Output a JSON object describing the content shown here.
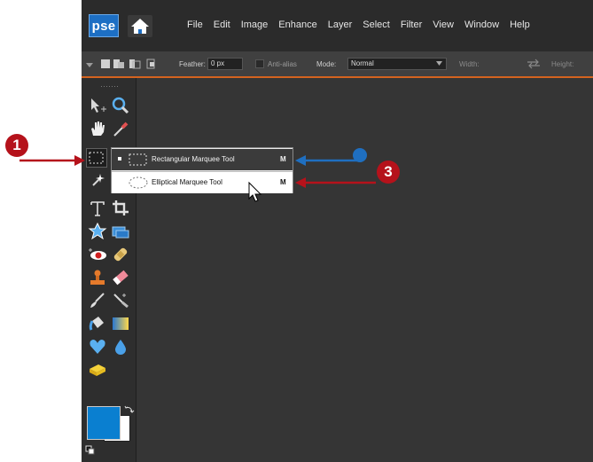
{
  "app": {
    "logo_text": "pse",
    "menu": [
      "File",
      "Edit",
      "Image",
      "Enhance",
      "Layer",
      "Select",
      "Filter",
      "View",
      "Window",
      "Help"
    ]
  },
  "options": {
    "feather_label": "Feather:",
    "feather_value": "0 px",
    "antialias_label": "Anti-alias",
    "mode_label": "Mode:",
    "mode_value": "Normal",
    "width_label": "Width:",
    "height_label": "Height:"
  },
  "flyout": {
    "items": [
      {
        "label": "Rectangular Marquee Tool",
        "shortcut": "M",
        "selected": true
      },
      {
        "label": "Elliptical Marquee Tool",
        "shortcut": "M",
        "selected": false
      }
    ]
  },
  "callouts": {
    "one": "1",
    "three": "3"
  },
  "colors": {
    "foreground": "#0a7fd0",
    "background": "#ffffff",
    "accent_bar": "#d4631f",
    "callout_red": "#b5121b",
    "callout_blue": "#1f6fc0"
  }
}
